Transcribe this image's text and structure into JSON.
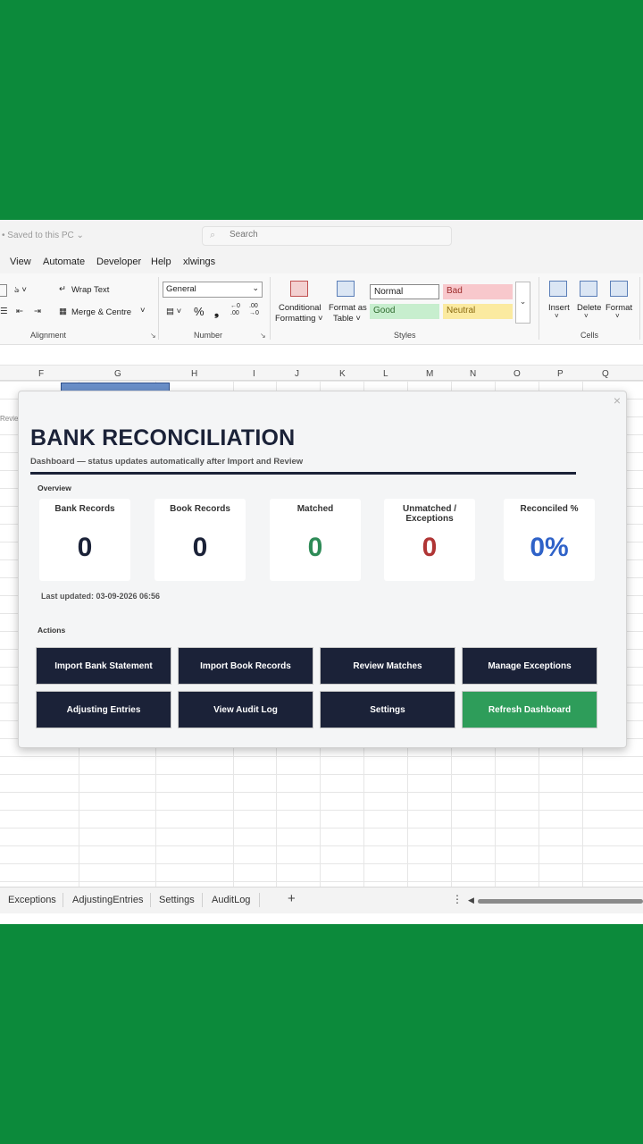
{
  "titlebar": {
    "saved_text": "• Saved to this PC ⌄",
    "search_placeholder": "Search"
  },
  "menu": [
    "View",
    "Automate",
    "Developer",
    "Help",
    "xlwings"
  ],
  "ribbon": {
    "wrap_text": "Wrap Text",
    "merge_centre": "Merge & Centre",
    "alignment_label": "Alignment",
    "number_format": "General",
    "number_label": "Number",
    "percent": "%",
    "comma": "❟",
    "dec_inc": "←0 .00",
    "dec_dec": ".00 →0",
    "cond_format_1": "Conditional",
    "cond_format_2": "Formatting ˅",
    "format_table_1": "Format as",
    "format_table_2": "Table ˅",
    "styles": {
      "normal": "Normal",
      "bad": "Bad",
      "good": "Good",
      "neutral": "Neutral"
    },
    "styles_label": "Styles",
    "insert": "Insert",
    "delete": "Delete",
    "format": "Format",
    "cells_label": "Cells"
  },
  "columns": [
    "F",
    "G",
    "H",
    "I",
    "J",
    "K",
    "L",
    "M",
    "N",
    "O",
    "P",
    "Q"
  ],
  "row_fragment": "Revie",
  "dialog": {
    "title": "BANK RECONCILIATION",
    "subtitle": "Dashboard — status updates automatically after Import and Review",
    "overview_label": "Overview",
    "cards": [
      {
        "label": "Bank Records",
        "value": "0",
        "color": "#1b2238"
      },
      {
        "label": "Book Records",
        "value": "0",
        "color": "#1b2238"
      },
      {
        "label": "Matched",
        "value": "0",
        "color": "#2e8b57"
      },
      {
        "label": "Unmatched / Exceptions",
        "value": "0",
        "color": "#b03535"
      },
      {
        "label": "Reconciled %",
        "value": "0%",
        "color": "#2f62c8"
      }
    ],
    "last_updated": "Last updated: 03-09-2026 06:56",
    "actions_label": "Actions",
    "buttons": [
      "Import Bank Statement",
      "Import Book Records",
      "Review Matches",
      "Manage Exceptions",
      "Adjusting Entries",
      "View Audit Log",
      "Settings",
      "Refresh Dashboard"
    ],
    "close": "×"
  },
  "sheet_tabs": [
    "Exceptions",
    "AdjustingEntries",
    "Settings",
    "AuditLog"
  ],
  "add_sheet": "+",
  "more": "⋮",
  "colors": {
    "navy": "#1b2238",
    "green_bg": "#0c8a3b",
    "refresh_green": "#2e9d5a"
  }
}
